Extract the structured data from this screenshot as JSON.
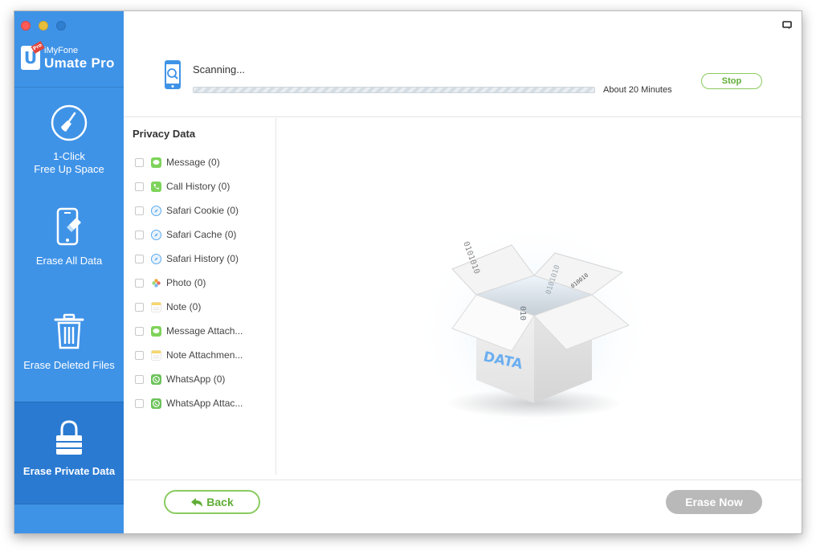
{
  "app": {
    "brand_sub": "iMyFone",
    "brand_main": "Umate Pro",
    "logo_letter": "U",
    "logo_badge": "Pro"
  },
  "colors": {
    "sidebar": "#3f93e7",
    "sidebar_active": "#2a7ad2",
    "accent_green": "#5fad35",
    "disabled_gray": "#b9b9b9"
  },
  "sidebar": {
    "items": [
      {
        "label_line1": "1-Click",
        "label_line2": "Free Up Space",
        "icon": "broom-icon",
        "active": false
      },
      {
        "label_line1": "Erase All Data",
        "label_line2": "",
        "icon": "phone-eraser-icon",
        "active": false
      },
      {
        "label_line1": "Erase Deleted Files",
        "label_line2": "",
        "icon": "trash-icon",
        "active": false
      },
      {
        "label_line1": "Erase Private Data",
        "label_line2": "",
        "icon": "lock-icon",
        "active": true
      }
    ]
  },
  "scan": {
    "status": "Scanning...",
    "eta": "About 20 Minutes",
    "progress_percent": 0,
    "stop_label": "Stop"
  },
  "privacy": {
    "title": "Privacy Data",
    "items": [
      {
        "label": "Message (0)",
        "icon": "message-icon",
        "icon_color": "#7ed35a"
      },
      {
        "label": "Call History (0)",
        "icon": "phone-icon",
        "icon_color": "#7ed35a"
      },
      {
        "label": "Safari Cookie (0)",
        "icon": "safari-icon",
        "icon_color": "#5aa9ec"
      },
      {
        "label": "Safari Cache (0)",
        "icon": "safari-icon",
        "icon_color": "#5aa9ec"
      },
      {
        "label": "Safari History (0)",
        "icon": "safari-icon",
        "icon_color": "#5aa9ec"
      },
      {
        "label": "Photo (0)",
        "icon": "photo-icon",
        "icon_color": "#f2a33a"
      },
      {
        "label": "Note (0)",
        "icon": "note-icon",
        "icon_color": "#f5d76e"
      },
      {
        "label": "Message Attach...",
        "icon": "message-icon",
        "icon_color": "#7ed35a"
      },
      {
        "label": "Note Attachmen...",
        "icon": "note-icon",
        "icon_color": "#f5d76e"
      },
      {
        "label": "WhatsApp (0)",
        "icon": "whatsapp-icon",
        "icon_color": "#6cc25a"
      },
      {
        "label": "WhatsApp Attac...",
        "icon": "whatsapp-icon",
        "icon_color": "#6cc25a"
      }
    ]
  },
  "illustration": {
    "box_label": "DATA",
    "binary_1": "0101010",
    "binary_2": "0101010",
    "binary_3": "010",
    "binary_4": "010010"
  },
  "footer": {
    "back_label": "Back",
    "erase_label": "Erase Now"
  }
}
